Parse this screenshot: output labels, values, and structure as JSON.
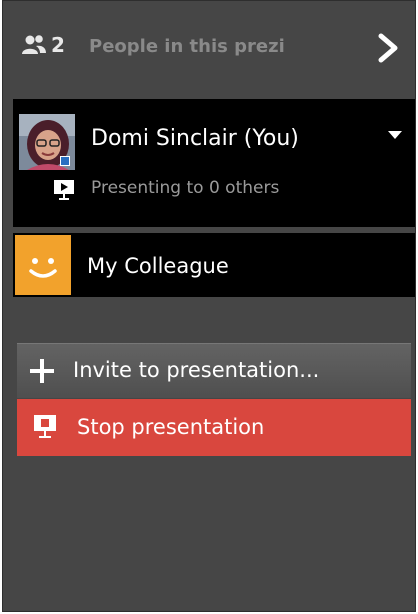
{
  "header": {
    "people_count": "2",
    "title": "People in this prezi",
    "icons": {
      "people": "people-icon",
      "collapse": "chevron-right-icon"
    }
  },
  "current_user": {
    "name": "Domi Sinclair (You)",
    "status": "Presenting to 0 others",
    "icons": {
      "menu": "caret-down-icon",
      "status": "presentation-screen-icon"
    }
  },
  "participants": [
    {
      "name": "My Colleague",
      "avatar_color": "#f2a22c",
      "icon": "smiley-face-icon"
    }
  ],
  "actions": {
    "invite_label": "Invite to presentation...",
    "stop_label": "Stop presentation",
    "icons": {
      "invite": "plus-icon",
      "stop": "presentation-screen-icon"
    }
  },
  "colors": {
    "panel_bg": "#464646",
    "card_bg": "#000000",
    "muted_text": "#8a8a8a",
    "stop_red": "#d9473e",
    "invite_gray": "#5a5a5a"
  }
}
